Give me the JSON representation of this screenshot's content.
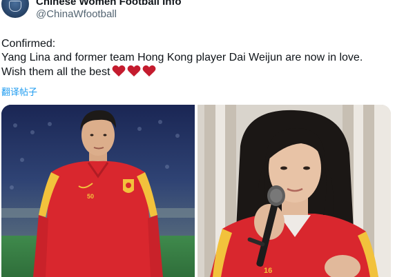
{
  "tweet": {
    "display_name": "Chinese Women Football Info",
    "handle": "@ChinaWfootball",
    "more_glyph": "···",
    "text_lines": [
      "Confirmed:",
      "Yang Lina and former team Hong Kong player Dai Weijun are now in love.",
      "Wish them all the best"
    ],
    "hearts_count": 3,
    "translate_label": "翻译帖子"
  },
  "media": {
    "left_photo": {
      "jersey_number": "50"
    },
    "right_photo": {
      "jersey_number": "16"
    }
  },
  "colors": {
    "text_primary": "#0f1419",
    "text_secondary": "#536471",
    "link": "#1d9bf0",
    "heart": "#c41b2e",
    "jersey_red": "#d9272e",
    "jersey_yellow": "#f2c23c"
  }
}
